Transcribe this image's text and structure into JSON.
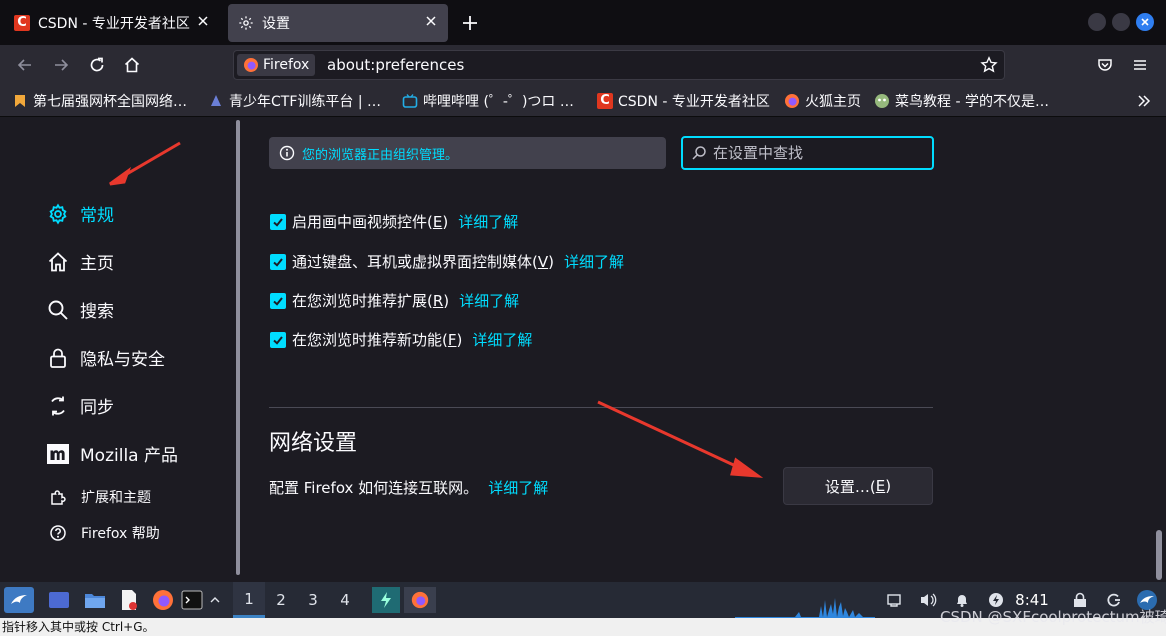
{
  "tabs": [
    {
      "title": "CSDN - 专业开发者社区",
      "favicon": "csdn-logo"
    },
    {
      "title": "设置",
      "favicon": "gear-icon"
    }
  ],
  "urlbar": {
    "identity": "Firefox",
    "url": "about:preferences"
  },
  "bookmarks": [
    {
      "label": "第七届强网杯全国网络…"
    },
    {
      "label": "青少年CTF训练平台 | …"
    },
    {
      "label": "哔哩哔哩 (゜-゜)つロ …"
    },
    {
      "label": "CSDN - 专业开发者社区"
    },
    {
      "label": "火狐主页"
    },
    {
      "label": "菜鸟教程 - 学的不仅是…"
    }
  ],
  "sidebar": {
    "items": [
      {
        "label": "常规",
        "icon": "gear-icon",
        "selected": true
      },
      {
        "label": "主页",
        "icon": "home-icon"
      },
      {
        "label": "搜索",
        "icon": "search-icon"
      },
      {
        "label": "隐私与安全",
        "icon": "lock-icon"
      },
      {
        "label": "同步",
        "icon": "sync-icon"
      },
      {
        "label": "Mozilla 产品",
        "icon": "mozilla-icon"
      }
    ],
    "footer": [
      {
        "label": "扩展和主题",
        "icon": "puzzle-icon"
      },
      {
        "label": "Firefox 帮助",
        "icon": "help-icon"
      }
    ]
  },
  "content": {
    "managed_notice": "您的浏览器正由组织管理。",
    "search_placeholder": "在设置中查找",
    "options": [
      {
        "text": "启用画中画视频控件(",
        "key": "E",
        "end": ")",
        "link": "详细了解",
        "checked": true
      },
      {
        "text": "通过键盘、耳机或虚拟界面控制媒体(",
        "key": "V",
        "end": ")",
        "link": "详细了解",
        "checked": true
      },
      {
        "text": "在您浏览时推荐扩展(",
        "key": "R",
        "end": ")",
        "link": "详细了解",
        "checked": true
      },
      {
        "text": "在您浏览时推荐新功能(",
        "key": "F",
        "end": ")",
        "link": "详细了解",
        "checked": true
      }
    ],
    "network": {
      "title": "网络设置",
      "desc": "配置 Firefox 如何连接互联网。",
      "link": "详细了解",
      "button_text": "设置…(",
      "button_key": "E",
      "button_end": ")"
    }
  },
  "taskbar": {
    "workspaces": [
      "1",
      "2",
      "3",
      "4"
    ],
    "clock": "8:41"
  },
  "statusbar": "指针移入其中或按 Ctrl+G。",
  "watermark": "CSDN @SXFcoolprotectum被琦",
  "colors": {
    "accent": "#00ddff",
    "page_bg": "#1c1b22",
    "toolbar_bg": "#2b2a33",
    "tab_active": "#42414d",
    "annotation": "#e8382d"
  }
}
